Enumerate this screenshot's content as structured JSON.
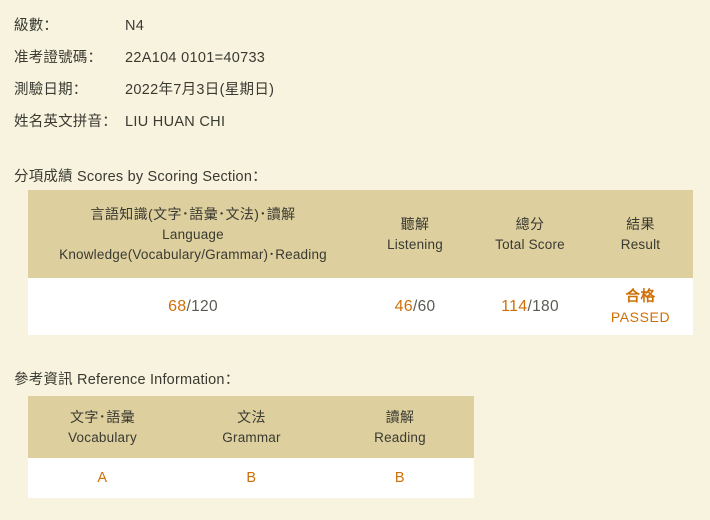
{
  "page": {
    "background_color": "#f7f3de",
    "text_color": "#3a3a32",
    "accent_color": "#cf6f08",
    "table_header_color": "#ddcf9e",
    "table_body_color": "#ffffff"
  },
  "candidate_info": [
    {
      "label": "級數：",
      "value": "N4"
    },
    {
      "label": "准考證號碼：",
      "value": "22A104 0101=40733"
    },
    {
      "label": "測驗日期：",
      "value": "2022年7月3日(星期日)"
    },
    {
      "label": "姓名英文拼音：",
      "value": "LIU HUAN CHI"
    }
  ],
  "scores_section": {
    "caption": "分項成績 Scores by Scoring Section：",
    "columns": [
      {
        "cjk": "言語知識(文字･語彙･文法)･讀解",
        "en_line1": "Language",
        "en_line2": "Knowledge(Vocabulary/Grammar)･Reading"
      },
      {
        "cjk": "聽解",
        "en_line1": "Listening",
        "en_line2": ""
      },
      {
        "cjk": "總分",
        "en_line1": "Total Score",
        "en_line2": ""
      },
      {
        "cjk": "結果",
        "en_line1": "Result",
        "en_line2": ""
      }
    ],
    "values": {
      "language_score": "68",
      "language_max": "/120",
      "listening_score": "46",
      "listening_max": "/60",
      "total_score": "114",
      "total_max": "/180",
      "result_cjk": "合格",
      "result_en": "PASSED"
    }
  },
  "reference_section": {
    "caption": "參考資訊 Reference Information：",
    "columns": [
      {
        "cjk": "文字･語彙",
        "en": "Vocabulary"
      },
      {
        "cjk": "文法",
        "en": "Grammar"
      },
      {
        "cjk": "讀解",
        "en": "Reading"
      }
    ],
    "grades": [
      "A",
      "B",
      "B"
    ]
  }
}
